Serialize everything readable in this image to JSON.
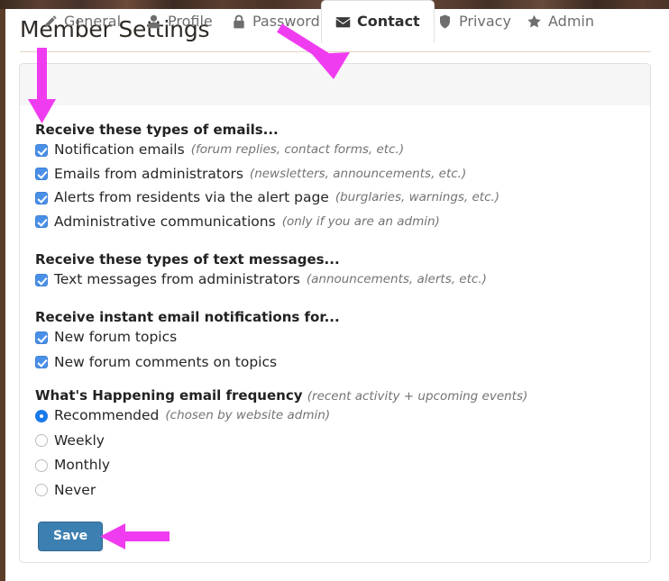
{
  "page": {
    "title": "Member Settings"
  },
  "tabs": [
    {
      "label": "General",
      "icon": "pencil-icon",
      "active": false
    },
    {
      "label": "Profile",
      "icon": "user-icon",
      "active": false
    },
    {
      "label": "Password",
      "icon": "lock-icon",
      "active": false
    },
    {
      "label": "Contact",
      "icon": "envelope-icon",
      "active": true
    },
    {
      "label": "Privacy",
      "icon": "shield-icon",
      "active": false
    },
    {
      "label": "Admin",
      "icon": "star-icon",
      "active": false
    }
  ],
  "sections": {
    "emails": {
      "heading": "Receive these types of emails...",
      "options": [
        {
          "label": "Notification emails",
          "hint": "(forum replies, contact forms, etc.)",
          "checked": true
        },
        {
          "label": "Emails from administrators",
          "hint": "(newsletters, announcements, etc.)",
          "checked": true
        },
        {
          "label": "Alerts from residents via the alert page",
          "hint": "(burglaries, warnings, etc.)",
          "checked": true
        },
        {
          "label": "Administrative communications",
          "hint": "(only if you are an admin)",
          "checked": true
        }
      ]
    },
    "texts": {
      "heading": "Receive these types of text messages...",
      "options": [
        {
          "label": "Text messages from administrators",
          "hint": "(announcements, alerts, etc.)",
          "checked": true
        }
      ]
    },
    "instant": {
      "heading": "Receive instant email notifications for...",
      "options": [
        {
          "label": "New forum topics",
          "hint": "",
          "checked": true
        },
        {
          "label": "New forum comments on topics",
          "hint": "",
          "checked": true
        }
      ]
    },
    "frequency": {
      "heading": "What's Happening email frequency",
      "heading_hint": "(recent activity + upcoming events)",
      "options": [
        {
          "label": "Recommended",
          "hint": "(chosen by website admin)",
          "selected": true
        },
        {
          "label": "Weekly",
          "hint": "",
          "selected": false
        },
        {
          "label": "Monthly",
          "hint": "",
          "selected": false
        },
        {
          "label": "Never",
          "hint": "",
          "selected": false
        }
      ]
    }
  },
  "actions": {
    "save_label": "Save"
  },
  "annotations": {
    "arrow_color": "#F03CF0",
    "arrows": [
      {
        "name": "arrow-pointing-to-receive-emails-heading",
        "direction": "down"
      },
      {
        "name": "arrow-pointing-to-contact-tab",
        "direction": "down-right"
      },
      {
        "name": "arrow-pointing-to-save-button",
        "direction": "left"
      }
    ]
  },
  "colors": {
    "checkbox_blue": "#4a90e8",
    "radio_blue": "#1a7aeb",
    "save_button_blue": "#3c7fb1",
    "title_rule": "#e2d4c3",
    "page_edge_brown": "#5a3d28"
  }
}
